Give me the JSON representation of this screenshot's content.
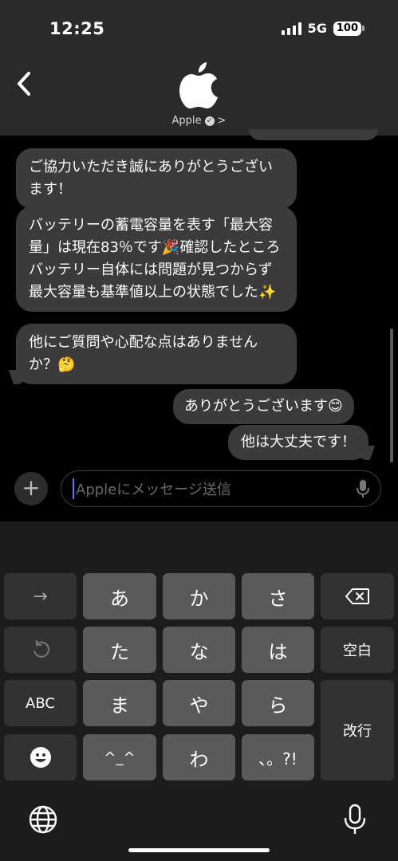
{
  "status_bar": {
    "time": "12:25",
    "network": "5G",
    "battery": "100"
  },
  "header": {
    "contact_name": "Apple",
    "contact_chevron": ">"
  },
  "messages": [
    {
      "from": "business",
      "text": "ご協力いただき誠にありがとうございます！"
    },
    {
      "from": "business",
      "text": "バッテリーの蓄電容量を表す「最大容量」は現在83％です🎉確認したところバッテリー自体には問題が見つからず最大容量も基準値以上の状態でした✨"
    },
    {
      "from": "business",
      "text": "他にご質問や心配な点はありませんか？🤔"
    },
    {
      "from": "user",
      "text": "ありがとうございます😊"
    },
    {
      "from": "user",
      "text": "他は大丈夫です！"
    }
  ],
  "composer": {
    "plus": "+",
    "placeholder": "Appleにメッセージ送信"
  },
  "keyboard": {
    "row1": [
      "→",
      "あ",
      "か",
      "さ"
    ],
    "row2": [
      "た",
      "な",
      "は",
      "空白"
    ],
    "row3": [
      "ABC",
      "ま",
      "や",
      "ら"
    ],
    "row4": [
      "^_^",
      "わ",
      "、。?!"
    ],
    "return": "改行"
  }
}
